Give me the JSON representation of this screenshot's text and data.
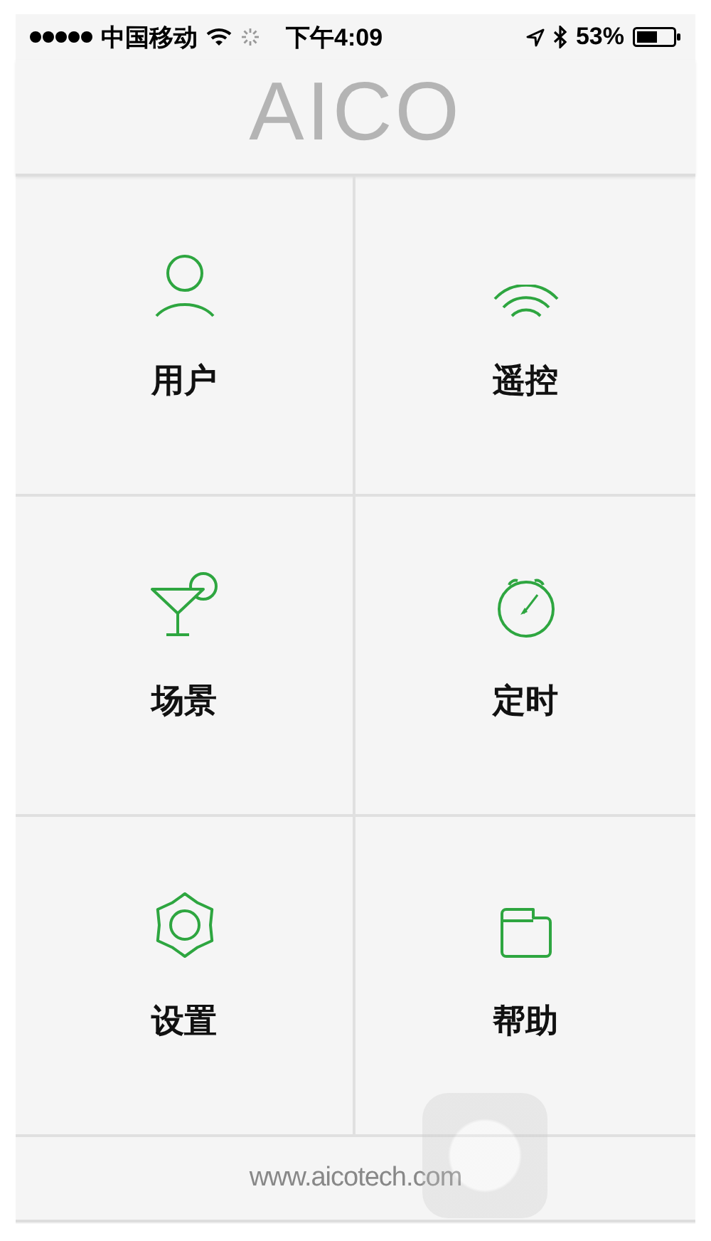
{
  "status_bar": {
    "carrier": "中国移动",
    "time": "下午4:09",
    "battery": "53%"
  },
  "header": {
    "logo": "AICO"
  },
  "menu": [
    {
      "kind": "user",
      "label": "用户"
    },
    {
      "kind": "remote",
      "label": "遥控"
    },
    {
      "kind": "scene",
      "label": "场景"
    },
    {
      "kind": "timer",
      "label": "定时"
    },
    {
      "kind": "settings",
      "label": "设置"
    },
    {
      "kind": "help",
      "label": "帮助"
    }
  ],
  "footer": {
    "link": "www.aicotech.com"
  }
}
